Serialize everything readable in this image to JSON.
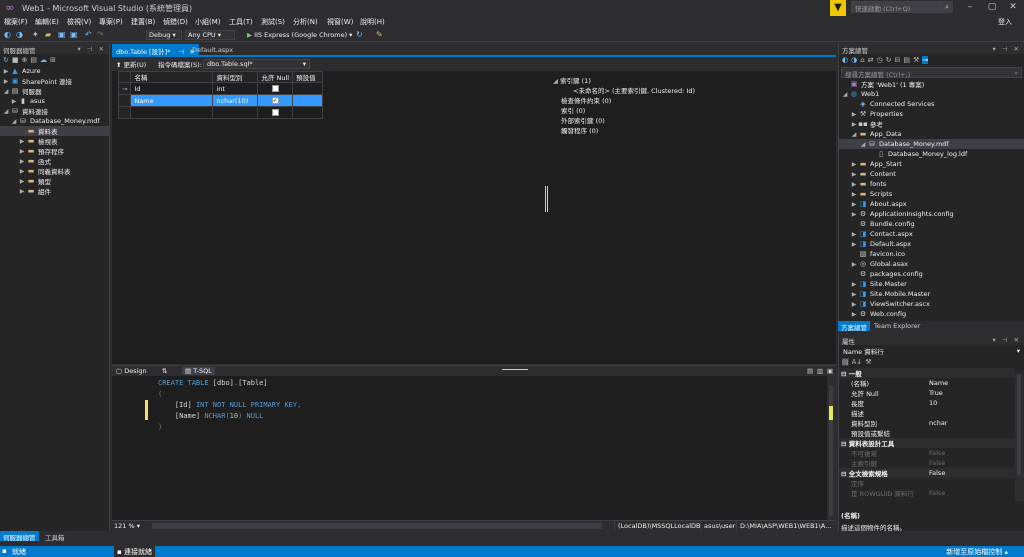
{
  "window": {
    "title": "Web1 - Microsoft Visual Studio (系統管理員)",
    "quick_launch_placeholder": "快速啟動 (Ctrl+Q)",
    "sign_in": "登入"
  },
  "menu": [
    "檔案(F)",
    "編輯(E)",
    "檢視(V)",
    "專案(P)",
    "建置(B)",
    "偵錯(D)",
    "小組(M)",
    "工具(T)",
    "測試(S)",
    "分析(N)",
    "視窗(W)",
    "說明(H)"
  ],
  "toolbar": {
    "config": "Debug",
    "platform": "Any CPU",
    "run_target": "IIS Express (Google Chrome)"
  },
  "server_explorer": {
    "title": "伺服器總管",
    "nodes": [
      {
        "label": "Azure",
        "icon": "azure-icon",
        "level": 0,
        "arrow": "▶"
      },
      {
        "label": "SharePoint 連接",
        "icon": "sharepoint-icon",
        "level": 0,
        "arrow": "▶"
      },
      {
        "label": "伺服器",
        "icon": "server-icon",
        "level": 0,
        "arrow": "◢"
      },
      {
        "label": "asus",
        "icon": "computer-icon",
        "level": 1,
        "arrow": "▶"
      },
      {
        "label": "資料連接",
        "icon": "data-connection-icon",
        "level": 0,
        "arrow": "◢"
      },
      {
        "label": "Database_Money.mdf",
        "icon": "database-icon",
        "level": 1,
        "arrow": "◢"
      },
      {
        "label": "資料表",
        "icon": "folder-icon",
        "level": 2,
        "arrow": "",
        "selected": true
      },
      {
        "label": "檢視表",
        "icon": "folder-icon",
        "level": 2,
        "arrow": "▶"
      },
      {
        "label": "預存程序",
        "icon": "folder-icon",
        "level": 2,
        "arrow": "▶"
      },
      {
        "label": "函式",
        "icon": "folder-icon",
        "level": 2,
        "arrow": "▶"
      },
      {
        "label": "同義資料表",
        "icon": "folder-icon",
        "level": 2,
        "arrow": "▶"
      },
      {
        "label": "類型",
        "icon": "folder-icon",
        "level": 2,
        "arrow": "▶"
      },
      {
        "label": "組件",
        "icon": "folder-icon",
        "level": 2,
        "arrow": "▶"
      }
    ],
    "bottom_tabs": [
      "伺服器總管",
      "工具箱"
    ]
  },
  "doc_tabs": [
    {
      "label": "dbo.Table [設計]*",
      "active": true
    },
    {
      "label": "Default.aspx",
      "active": false
    }
  ],
  "designer": {
    "update_label": "更新(U)",
    "script_label": "指令碼檔案(S):",
    "script_file": "dbo.Table.sql*",
    "columns": [
      "名稱",
      "資料型別",
      "允許 Null",
      "預設值"
    ],
    "rows": [
      {
        "marker": "⊸",
        "name": "Id",
        "type": "int",
        "nullable": false,
        "selected": false
      },
      {
        "marker": "",
        "name": "Name",
        "type": "nchar(10)",
        "nullable": true,
        "selected": true
      },
      {
        "marker": "",
        "name": "",
        "type": "",
        "nullable": false,
        "selected": false
      }
    ],
    "keys": {
      "primary_header": "索引鍵 (1)",
      "primary_item": "<未命名的>   (主要索引鍵, Clustered: Id)",
      "check": "檢查條件約束 (0)",
      "index": "索引 (0)",
      "foreign": "外部索引鍵 (0)",
      "trigger": "觸發程序 (0)"
    }
  },
  "pane_tabs": {
    "design": "Design",
    "swap": "⇅",
    "tsql": "T-SQL"
  },
  "editor": {
    "lines": [
      {
        "parts": [
          {
            "t": "CREATE TABLE ",
            "c": "kw"
          },
          {
            "t": "[dbo]",
            "c": "tx"
          },
          {
            "t": ".",
            "c": "gray"
          },
          {
            "t": "[Table]",
            "c": "tx"
          }
        ]
      },
      {
        "parts": [
          {
            "t": "(",
            "c": "gray"
          }
        ]
      },
      {
        "parts": [
          {
            "t": "    [Id] ",
            "c": "tx"
          },
          {
            "t": "INT NOT NULL PRIMARY KEY",
            "c": "kw"
          },
          {
            "t": ",",
            "c": "gray"
          }
        ]
      },
      {
        "parts": [
          {
            "t": "    [Name] ",
            "c": "tx"
          },
          {
            "t": "NCHAR",
            "c": "kw"
          },
          {
            "t": "(",
            "c": "gray"
          },
          {
            "t": "10",
            "c": "num"
          },
          {
            "t": ") ",
            "c": "gray"
          },
          {
            "t": "NULL",
            "c": "kw"
          }
        ]
      },
      {
        "parts": [
          {
            "t": ")",
            "c": "gray"
          }
        ]
      }
    ],
    "zoom": "121 %",
    "status_boxes": [
      "(LocalDB)\\MSSQLLocalDB",
      "asus\\user",
      "D:\\MIA\\ASP\\WEB1\\WEB1\\A..."
    ]
  },
  "solution_explorer": {
    "title": "方案總管",
    "search_placeholder": "搜尋方案總管 (Ctrl+;)",
    "nodes": [
      {
        "label": "方案 'Web1' (1 專案)",
        "icon": "solution-icon",
        "level": 0,
        "arrow": ""
      },
      {
        "label": "Web1",
        "icon": "web-project-icon",
        "level": 0,
        "arrow": "◢"
      },
      {
        "label": "Connected Services",
        "icon": "connected-services-icon",
        "level": 1,
        "arrow": ""
      },
      {
        "label": "Properties",
        "icon": "properties-icon",
        "level": 1,
        "arrow": "▶"
      },
      {
        "label": "參考",
        "icon": "references-icon",
        "level": 1,
        "arrow": "▶"
      },
      {
        "label": "App_Data",
        "icon": "folder-icon",
        "level": 1,
        "arrow": "◢"
      },
      {
        "label": "Database_Money.mdf",
        "icon": "database-icon",
        "level": 2,
        "arrow": "◢",
        "selected": true
      },
      {
        "label": "Database_Money_log.ldf",
        "icon": "file-icon",
        "level": 3,
        "arrow": ""
      },
      {
        "label": "App_Start",
        "icon": "folder-icon",
        "level": 1,
        "arrow": "▶"
      },
      {
        "label": "Content",
        "icon": "folder-icon",
        "level": 1,
        "arrow": "▶"
      },
      {
        "label": "fonts",
        "icon": "folder-icon",
        "level": 1,
        "arrow": "▶"
      },
      {
        "label": "Scripts",
        "icon": "folder-icon",
        "level": 1,
        "arrow": "▶"
      },
      {
        "label": "About.aspx",
        "icon": "aspx-file-icon",
        "level": 1,
        "arrow": "▶"
      },
      {
        "label": "ApplicationInsights.config",
        "icon": "config-file-icon",
        "level": 1,
        "arrow": "▶"
      },
      {
        "label": "Bundle.config",
        "icon": "config-file-icon",
        "level": 1,
        "arrow": ""
      },
      {
        "label": "Contact.aspx",
        "icon": "aspx-file-icon",
        "level": 1,
        "arrow": "▶"
      },
      {
        "label": "Default.aspx",
        "icon": "aspx-file-icon",
        "level": 1,
        "arrow": "▶"
      },
      {
        "label": "favicon.ico",
        "icon": "image-file-icon",
        "level": 1,
        "arrow": ""
      },
      {
        "label": "Global.asax",
        "icon": "asax-file-icon",
        "level": 1,
        "arrow": "▶"
      },
      {
        "label": "packages.config",
        "icon": "config-file-icon",
        "level": 1,
        "arrow": ""
      },
      {
        "label": "Site.Master",
        "icon": "master-file-icon",
        "level": 1,
        "arrow": "▶"
      },
      {
        "label": "Site.Mobile.Master",
        "icon": "master-file-icon",
        "level": 1,
        "arrow": "▶"
      },
      {
        "label": "ViewSwitcher.ascx",
        "icon": "ascx-file-icon",
        "level": 1,
        "arrow": "▶"
      },
      {
        "label": "Web.config",
        "icon": "config-file-icon",
        "level": 1,
        "arrow": "▶"
      }
    ],
    "bottom_tabs": [
      "方案總管",
      "Team Explorer"
    ]
  },
  "properties": {
    "title": "屬性",
    "object": "Name 資料行",
    "rows": [
      {
        "kind": "cat",
        "name": "一般",
        "value": ""
      },
      {
        "kind": "prop",
        "name": "(名稱)",
        "value": "Name"
      },
      {
        "kind": "prop",
        "name": "允許 Null",
        "value": "True"
      },
      {
        "kind": "prop",
        "name": "長度",
        "value": "10"
      },
      {
        "kind": "prop",
        "name": "描述",
        "value": ""
      },
      {
        "kind": "prop",
        "name": "資料型別",
        "value": "nchar"
      },
      {
        "kind": "prop",
        "name": "預設值或繫結",
        "value": ""
      },
      {
        "kind": "cat",
        "name": "資料表設計工具",
        "value": ""
      },
      {
        "kind": "dim",
        "name": "不可複寫",
        "value": "False"
      },
      {
        "kind": "dim",
        "name": "主索引鍵",
        "value": "False"
      },
      {
        "kind": "cat",
        "name": "全文檢索規格",
        "value": "False"
      },
      {
        "kind": "dim",
        "name": "定序",
        "value": ""
      },
      {
        "kind": "dim",
        "name": "是 ROWGUID 資料行",
        "value": "False"
      }
    ],
    "desc_title": "(名稱)",
    "desc_text": "描述這個物件的名稱。"
  },
  "status": {
    "left": "就緒",
    "center": "連接就緒",
    "right": "新增至原始檔控制 ▴"
  }
}
